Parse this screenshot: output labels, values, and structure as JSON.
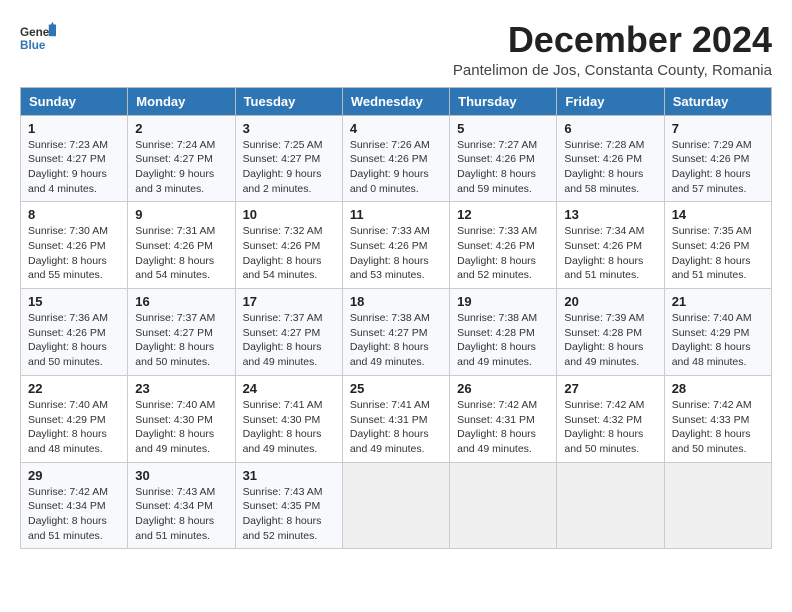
{
  "header": {
    "logo_line1": "General",
    "logo_line2": "Blue",
    "month_title": "December 2024",
    "location": "Pantelimon de Jos, Constanta County, Romania"
  },
  "days_of_week": [
    "Sunday",
    "Monday",
    "Tuesday",
    "Wednesday",
    "Thursday",
    "Friday",
    "Saturday"
  ],
  "weeks": [
    [
      {
        "day": 1,
        "sunrise": "7:23 AM",
        "sunset": "4:27 PM",
        "daylight": "9 hours and 4 minutes."
      },
      {
        "day": 2,
        "sunrise": "7:24 AM",
        "sunset": "4:27 PM",
        "daylight": "9 hours and 3 minutes."
      },
      {
        "day": 3,
        "sunrise": "7:25 AM",
        "sunset": "4:27 PM",
        "daylight": "9 hours and 2 minutes."
      },
      {
        "day": 4,
        "sunrise": "7:26 AM",
        "sunset": "4:26 PM",
        "daylight": "9 hours and 0 minutes."
      },
      {
        "day": 5,
        "sunrise": "7:27 AM",
        "sunset": "4:26 PM",
        "daylight": "8 hours and 59 minutes."
      },
      {
        "day": 6,
        "sunrise": "7:28 AM",
        "sunset": "4:26 PM",
        "daylight": "8 hours and 58 minutes."
      },
      {
        "day": 7,
        "sunrise": "7:29 AM",
        "sunset": "4:26 PM",
        "daylight": "8 hours and 57 minutes."
      }
    ],
    [
      {
        "day": 8,
        "sunrise": "7:30 AM",
        "sunset": "4:26 PM",
        "daylight": "8 hours and 55 minutes."
      },
      {
        "day": 9,
        "sunrise": "7:31 AM",
        "sunset": "4:26 PM",
        "daylight": "8 hours and 54 minutes."
      },
      {
        "day": 10,
        "sunrise": "7:32 AM",
        "sunset": "4:26 PM",
        "daylight": "8 hours and 54 minutes."
      },
      {
        "day": 11,
        "sunrise": "7:33 AM",
        "sunset": "4:26 PM",
        "daylight": "8 hours and 53 minutes."
      },
      {
        "day": 12,
        "sunrise": "7:33 AM",
        "sunset": "4:26 PM",
        "daylight": "8 hours and 52 minutes."
      },
      {
        "day": 13,
        "sunrise": "7:34 AM",
        "sunset": "4:26 PM",
        "daylight": "8 hours and 51 minutes."
      },
      {
        "day": 14,
        "sunrise": "7:35 AM",
        "sunset": "4:26 PM",
        "daylight": "8 hours and 51 minutes."
      }
    ],
    [
      {
        "day": 15,
        "sunrise": "7:36 AM",
        "sunset": "4:26 PM",
        "daylight": "8 hours and 50 minutes."
      },
      {
        "day": 16,
        "sunrise": "7:37 AM",
        "sunset": "4:27 PM",
        "daylight": "8 hours and 50 minutes."
      },
      {
        "day": 17,
        "sunrise": "7:37 AM",
        "sunset": "4:27 PM",
        "daylight": "8 hours and 49 minutes."
      },
      {
        "day": 18,
        "sunrise": "7:38 AM",
        "sunset": "4:27 PM",
        "daylight": "8 hours and 49 minutes."
      },
      {
        "day": 19,
        "sunrise": "7:38 AM",
        "sunset": "4:28 PM",
        "daylight": "8 hours and 49 minutes."
      },
      {
        "day": 20,
        "sunrise": "7:39 AM",
        "sunset": "4:28 PM",
        "daylight": "8 hours and 49 minutes."
      },
      {
        "day": 21,
        "sunrise": "7:40 AM",
        "sunset": "4:29 PM",
        "daylight": "8 hours and 48 minutes."
      }
    ],
    [
      {
        "day": 22,
        "sunrise": "7:40 AM",
        "sunset": "4:29 PM",
        "daylight": "8 hours and 48 minutes."
      },
      {
        "day": 23,
        "sunrise": "7:40 AM",
        "sunset": "4:30 PM",
        "daylight": "8 hours and 49 minutes."
      },
      {
        "day": 24,
        "sunrise": "7:41 AM",
        "sunset": "4:30 PM",
        "daylight": "8 hours and 49 minutes."
      },
      {
        "day": 25,
        "sunrise": "7:41 AM",
        "sunset": "4:31 PM",
        "daylight": "8 hours and 49 minutes."
      },
      {
        "day": 26,
        "sunrise": "7:42 AM",
        "sunset": "4:31 PM",
        "daylight": "8 hours and 49 minutes."
      },
      {
        "day": 27,
        "sunrise": "7:42 AM",
        "sunset": "4:32 PM",
        "daylight": "8 hours and 50 minutes."
      },
      {
        "day": 28,
        "sunrise": "7:42 AM",
        "sunset": "4:33 PM",
        "daylight": "8 hours and 50 minutes."
      }
    ],
    [
      {
        "day": 29,
        "sunrise": "7:42 AM",
        "sunset": "4:34 PM",
        "daylight": "8 hours and 51 minutes."
      },
      {
        "day": 30,
        "sunrise": "7:43 AM",
        "sunset": "4:34 PM",
        "daylight": "8 hours and 51 minutes."
      },
      {
        "day": 31,
        "sunrise": "7:43 AM",
        "sunset": "4:35 PM",
        "daylight": "8 hours and 52 minutes."
      },
      null,
      null,
      null,
      null
    ]
  ],
  "labels": {
    "sunrise": "Sunrise:",
    "sunset": "Sunset:",
    "daylight": "Daylight:"
  }
}
